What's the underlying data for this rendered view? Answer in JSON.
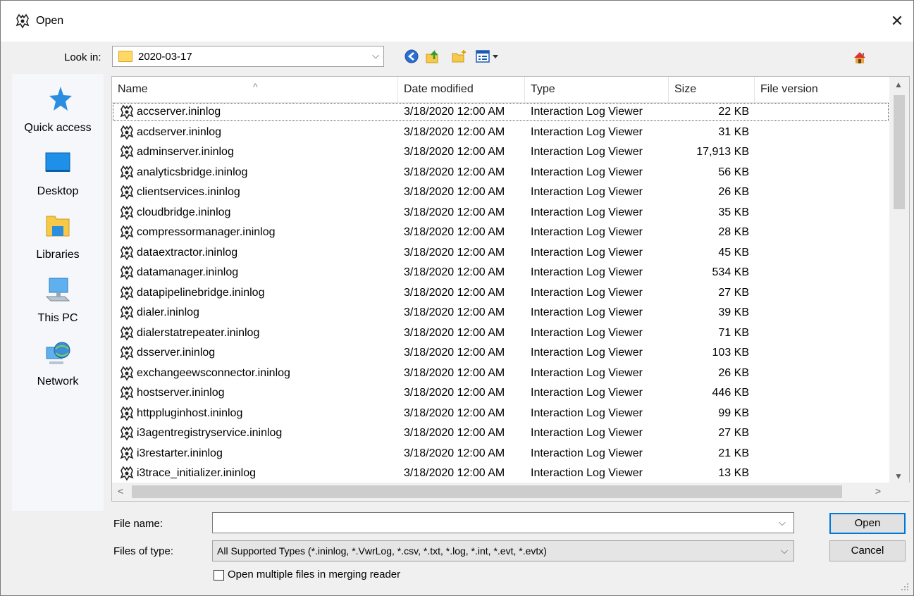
{
  "window": {
    "title": "Open",
    "close_glyph": "✕"
  },
  "look_in": {
    "label": "Look in:",
    "value": "2020-03-17"
  },
  "toolbar": {
    "icons": [
      "back-icon",
      "up-folder-icon",
      "new-folder-icon",
      "view-menu-icon",
      "home-icon"
    ]
  },
  "places": [
    {
      "label": "Quick access",
      "icon": "star-icon"
    },
    {
      "label": "Desktop",
      "icon": "desktop-icon"
    },
    {
      "label": "Libraries",
      "icon": "libraries-icon"
    },
    {
      "label": "This PC",
      "icon": "computer-icon"
    },
    {
      "label": "Network",
      "icon": "network-icon"
    }
  ],
  "columns": {
    "name": "Name",
    "date": "Date modified",
    "type": "Type",
    "size": "Size",
    "version": "File version"
  },
  "files": [
    {
      "name": "accserver.ininlog",
      "date": "3/18/2020 12:00 AM",
      "type": "Interaction Log Viewer",
      "size": "22 KB"
    },
    {
      "name": "acdserver.ininlog",
      "date": "3/18/2020 12:00 AM",
      "type": "Interaction Log Viewer",
      "size": "31 KB"
    },
    {
      "name": "adminserver.ininlog",
      "date": "3/18/2020 12:00 AM",
      "type": "Interaction Log Viewer",
      "size": "17,913 KB"
    },
    {
      "name": "analyticsbridge.ininlog",
      "date": "3/18/2020 12:00 AM",
      "type": "Interaction Log Viewer",
      "size": "56 KB"
    },
    {
      "name": "clientservices.ininlog",
      "date": "3/18/2020 12:00 AM",
      "type": "Interaction Log Viewer",
      "size": "26 KB"
    },
    {
      "name": "cloudbridge.ininlog",
      "date": "3/18/2020 12:00 AM",
      "type": "Interaction Log Viewer",
      "size": "35 KB"
    },
    {
      "name": "compressormanager.ininlog",
      "date": "3/18/2020 12:00 AM",
      "type": "Interaction Log Viewer",
      "size": "28 KB"
    },
    {
      "name": "dataextractor.ininlog",
      "date": "3/18/2020 12:00 AM",
      "type": "Interaction Log Viewer",
      "size": "45 KB"
    },
    {
      "name": "datamanager.ininlog",
      "date": "3/18/2020 12:00 AM",
      "type": "Interaction Log Viewer",
      "size": "534 KB"
    },
    {
      "name": "datapipelinebridge.ininlog",
      "date": "3/18/2020 12:00 AM",
      "type": "Interaction Log Viewer",
      "size": "27 KB"
    },
    {
      "name": "dialer.ininlog",
      "date": "3/18/2020 12:00 AM",
      "type": "Interaction Log Viewer",
      "size": "39 KB"
    },
    {
      "name": "dialerstatrepeater.ininlog",
      "date": "3/18/2020 12:00 AM",
      "type": "Interaction Log Viewer",
      "size": "71 KB"
    },
    {
      "name": "dsserver.ininlog",
      "date": "3/18/2020 12:00 AM",
      "type": "Interaction Log Viewer",
      "size": "103 KB"
    },
    {
      "name": "exchangeewsconnector.ininlog",
      "date": "3/18/2020 12:00 AM",
      "type": "Interaction Log Viewer",
      "size": "26 KB"
    },
    {
      "name": "hostserver.ininlog",
      "date": "3/18/2020 12:00 AM",
      "type": "Interaction Log Viewer",
      "size": "446 KB"
    },
    {
      "name": "httppluginhost.ininlog",
      "date": "3/18/2020 12:00 AM",
      "type": "Interaction Log Viewer",
      "size": "99 KB"
    },
    {
      "name": "i3agentregistryservice.ininlog",
      "date": "3/18/2020 12:00 AM",
      "type": "Interaction Log Viewer",
      "size": "27 KB"
    },
    {
      "name": "i3restarter.ininlog",
      "date": "3/18/2020 12:00 AM",
      "type": "Interaction Log Viewer",
      "size": "21 KB"
    },
    {
      "name": "i3trace_initializer.ininlog",
      "date": "3/18/2020 12:00 AM",
      "type": "Interaction Log Viewer",
      "size": "13 KB"
    }
  ],
  "file_name": {
    "label": "File name:",
    "value": ""
  },
  "file_type": {
    "label": "Files of type:",
    "value": "All Supported Types (*.ininlog, *.VwrLog, *.csv, *.txt, *.log, *.int, *.evt, *.evtx)"
  },
  "buttons": {
    "open": "Open",
    "cancel": "Cancel"
  },
  "merge_checkbox": {
    "label": "Open multiple files in merging reader",
    "checked": false
  }
}
